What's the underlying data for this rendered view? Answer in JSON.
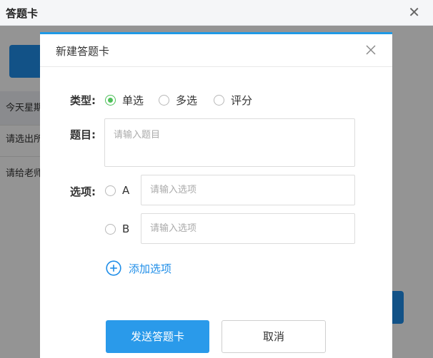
{
  "background": {
    "title": "答题卡",
    "close_icon": "close-icon",
    "list_items": [
      "今天星期",
      "请选出所",
      "请给老师"
    ]
  },
  "dialog": {
    "title": "新建答题卡",
    "close_icon": "close-icon",
    "type_label": "类型:",
    "type_options": [
      "单选",
      "多选",
      "评分"
    ],
    "type_selected": "单选",
    "question_label": "题目:",
    "question_placeholder": "请输入题目",
    "options_label": "选项:",
    "options": [
      {
        "letter": "A",
        "placeholder": "请输入选项"
      },
      {
        "letter": "B",
        "placeholder": "请输入选项"
      }
    ],
    "add_option_label": "添加选项",
    "submit_label": "发送答题卡",
    "cancel_label": "取消"
  },
  "colors": {
    "accent": "#1f8ee8",
    "radio_checked": "#4ec05a",
    "primary_button": "#2a9aea"
  }
}
